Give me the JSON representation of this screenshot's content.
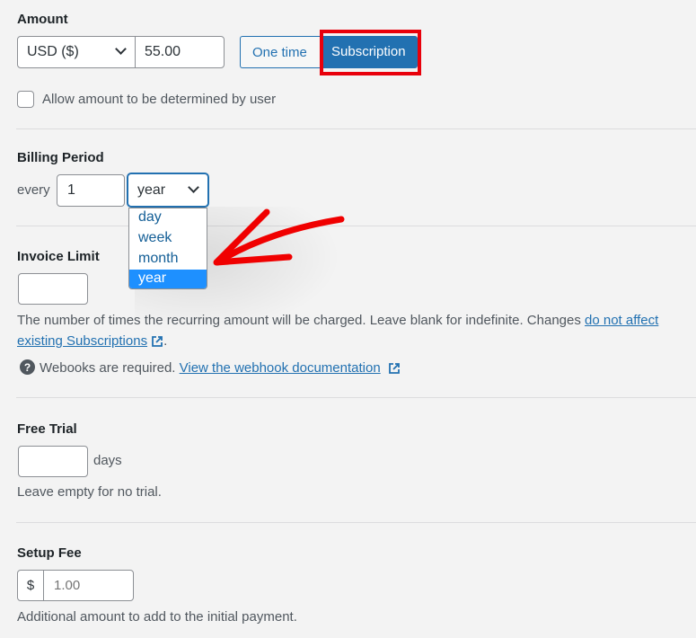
{
  "amount": {
    "label": "Amount",
    "currency": "USD ($)",
    "value": "55.00",
    "type_options": [
      "One time",
      "Subscription"
    ],
    "selected_type": "Subscription",
    "allow_user_amount_label": "Allow amount to be determined by user",
    "allow_user_amount_checked": false
  },
  "billing": {
    "label": "Billing Period",
    "every_label": "every",
    "interval": "1",
    "period": "year",
    "period_options": [
      "day",
      "week",
      "month",
      "year"
    ],
    "highlighted_option": "year"
  },
  "invoice": {
    "label": "Invoice Limit",
    "value": "",
    "help_prefix": "The number of times the recurring amount will be charged. Leave blank for indefinite. Changes ",
    "help_link_1": "do not affect",
    "help_link_2": "existing Subscriptions",
    "help_suffix": ".",
    "webhook_text": "Webooks are required. ",
    "webhook_link": "View the webhook documentation"
  },
  "free_trial": {
    "label": "Free Trial",
    "value": "",
    "unit": "days",
    "help": "Leave empty for no trial."
  },
  "setup_fee": {
    "label": "Setup Fee",
    "prefix": "$",
    "placeholder": "1.00",
    "help": "Additional amount to add to the initial payment."
  },
  "colors": {
    "accent": "#2271b1",
    "highlight_box": "#e8000b",
    "dropdown_selected": "#1e90ff"
  }
}
